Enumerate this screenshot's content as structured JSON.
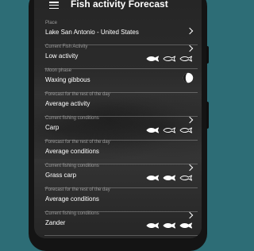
{
  "app": {
    "title": "Fish activity Forecast"
  },
  "place": {
    "label": "Place",
    "value": "Lake San Antonio - United States"
  },
  "current_activity": {
    "label": "Current Fish Activity",
    "value": "Low activity",
    "fish_level": 1,
    "fish_max": 3
  },
  "moon": {
    "label": "Moon phase",
    "value": "Waxing gibbous",
    "icon": "waxing-gibbous-moon-icon"
  },
  "forecast_rest_day": {
    "label": "Forecast for the rest of the day",
    "value": "Average activity"
  },
  "species": [
    {
      "conditions_label": "Current fishing conditions",
      "name": "Carp",
      "fish_level": 1,
      "fish_max": 3,
      "forecast_label": "Forecast for the rest of the day",
      "forecast_value": "Average conditions"
    },
    {
      "conditions_label": "Current fishing conditions",
      "name": "Grass carp",
      "fish_level": 2,
      "fish_max": 3,
      "forecast_label": "Forecast for the rest of the day",
      "forecast_value": "Average conditions"
    },
    {
      "conditions_label": "Current fishing conditions",
      "name": "Zander",
      "fish_level": 3,
      "fish_max": 3
    }
  ],
  "colors": {
    "background": "#2d6d76",
    "text": "#ffffff",
    "label": "#9a9a9a",
    "fish_filled": "#ffffff"
  }
}
